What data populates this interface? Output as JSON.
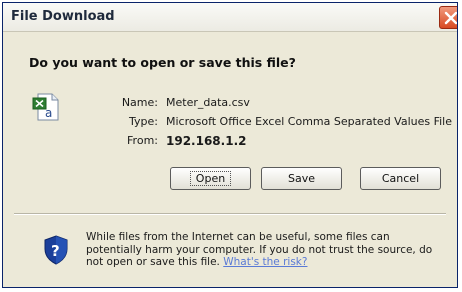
{
  "window": {
    "title": "File Download"
  },
  "dialog": {
    "question": "Do you want to open or save this file?",
    "file": {
      "name_label": "Name:",
      "name_value": "Meter_data.csv",
      "type_label": "Type:",
      "type_value": "Microsoft Office Excel Comma Separated Values File",
      "from_label": "From:",
      "from_value": "192.168.1.2"
    },
    "buttons": {
      "open": "Open",
      "save": "Save",
      "cancel": "Cancel"
    },
    "warning": {
      "text": "While files from the Internet can be useful, some files can potentially harm your computer. If you do not trust the source, do not open or save this file.",
      "link": "What's the risk?"
    }
  },
  "icons": {
    "file": "excel-csv-file-icon",
    "close": "close-icon",
    "shield": "security-shield-icon"
  },
  "colors": {
    "close_button": "#d84a23",
    "link": "#5a7ad6",
    "shield": "#1b3f9a"
  }
}
